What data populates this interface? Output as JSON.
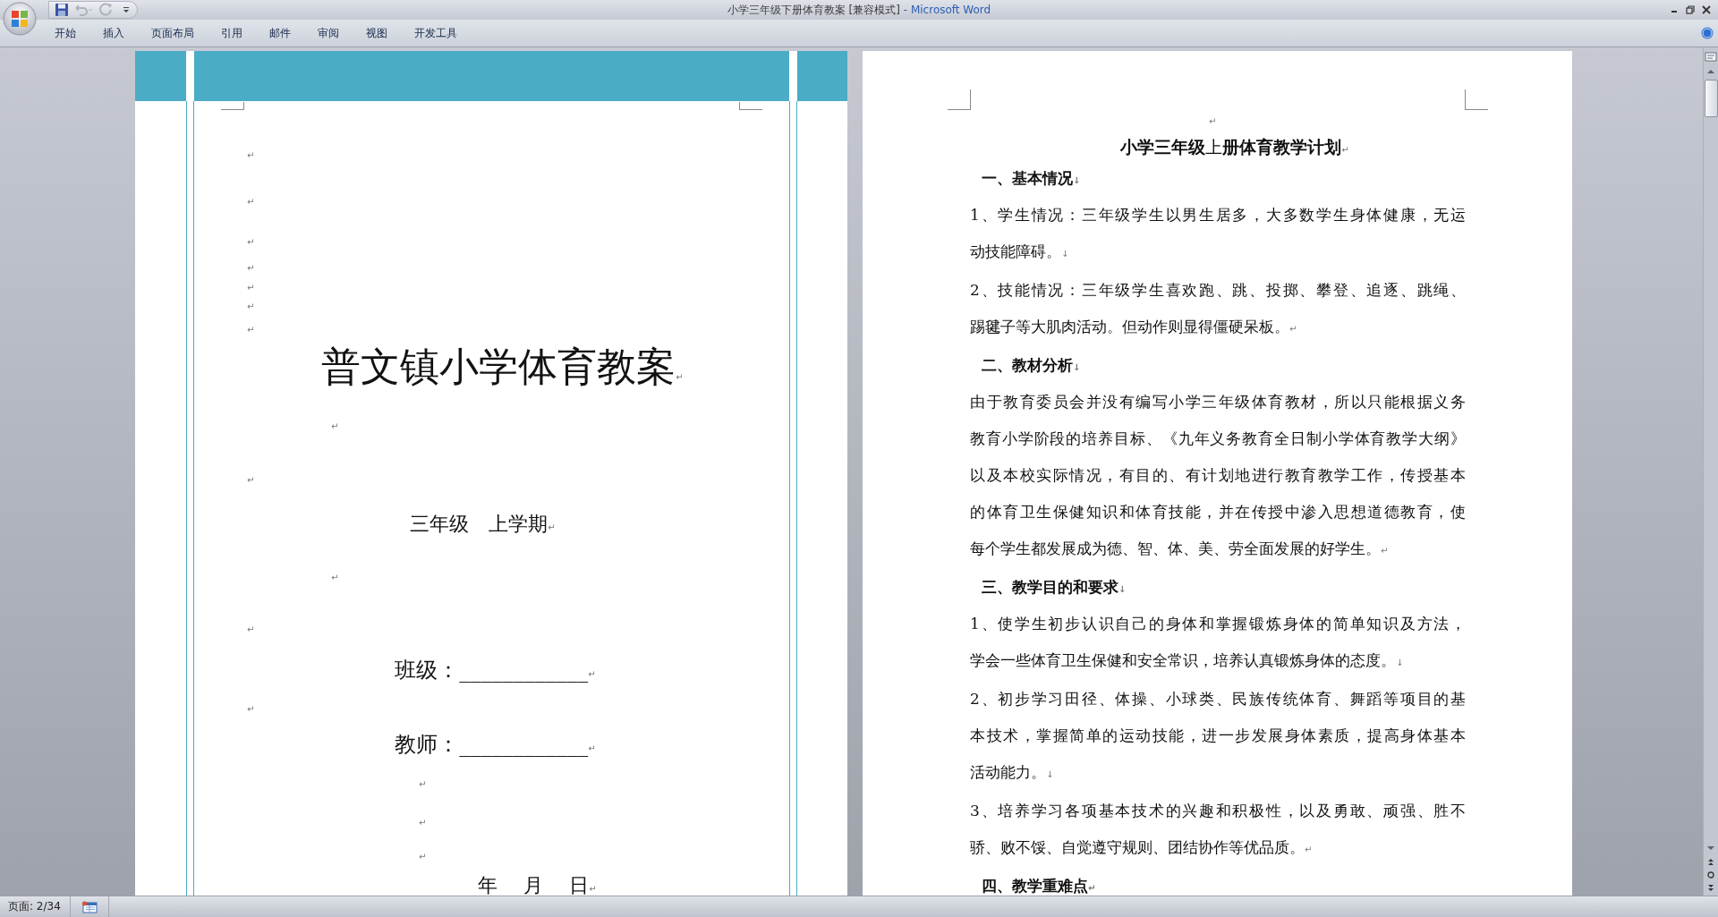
{
  "window": {
    "document_title": "小学三年级下册体育教案 [兼容模式]",
    "app_label": "- Microsoft Word"
  },
  "quick_access": [
    {
      "kind": "save",
      "disabled": false
    },
    {
      "kind": "undo",
      "disabled": true
    },
    {
      "kind": "redo",
      "disabled": true
    },
    {
      "kind": "customize",
      "disabled": false
    }
  ],
  "ribbon_tabs": [
    {
      "label": "开始",
      "selected": false
    },
    {
      "label": "插入",
      "selected": false
    },
    {
      "label": "页面布局",
      "selected": false
    },
    {
      "label": "引用",
      "selected": false
    },
    {
      "label": "邮件",
      "selected": false
    },
    {
      "label": "审阅",
      "selected": false
    },
    {
      "label": "视图",
      "selected": false
    },
    {
      "label": "开发工具",
      "selected": false
    }
  ],
  "left_page": {
    "paragraphs": [
      {
        "kind": "blank",
        "mark": "↵"
      },
      {
        "kind": "blank",
        "mark": "↵"
      },
      {
        "kind": "blank",
        "mark": "↵"
      },
      {
        "kind": "blank",
        "mark": "↵"
      },
      {
        "kind": "blank",
        "mark": "↵"
      },
      {
        "kind": "blank",
        "mark": "↵"
      },
      {
        "kind": "blank",
        "mark": "↵"
      },
      {
        "kind": "title",
        "text": "普文镇小学体育教案",
        "mark": "↵"
      },
      {
        "kind": "blank",
        "mark": "↵"
      },
      {
        "kind": "blank",
        "mark": "↵"
      },
      {
        "kind": "subtitle",
        "text": "三年级　上学期",
        "mark": "↵"
      },
      {
        "kind": "blank",
        "mark": "↵"
      },
      {
        "kind": "blank",
        "mark": "↵"
      },
      {
        "kind": "field",
        "text": "班级：____________",
        "mark": "↵"
      },
      {
        "kind": "blank",
        "mark": "↵"
      },
      {
        "kind": "field",
        "text": "教师：____________",
        "mark": "↵"
      },
      {
        "kind": "blank",
        "mark": "↵"
      },
      {
        "kind": "blank",
        "mark": "↵"
      },
      {
        "kind": "blank",
        "mark": "↵"
      },
      {
        "kind": "date",
        "text": "年　 月　 日",
        "mark": "↵"
      }
    ]
  },
  "right_page": {
    "paragraphs": [
      {
        "kind": "blank",
        "mark": "↵"
      },
      {
        "kind": "title",
        "text": "**小学三年级**上**册体育教学计划**",
        "mark": "↵"
      },
      {
        "kind": "heading",
        "text": "一、基本情况",
        "mark": "↓"
      },
      {
        "kind": "body",
        "lines": [
          "1、学生情况：三年级学生以男生居多，大多数学生身体健康，无运",
          "动技能障碍。"
        ],
        "mark": "↓"
      },
      {
        "kind": "body",
        "lines": [
          "2、技能情况：三年级学生喜欢跑、跳、投掷、攀登、追逐、跳绳、",
          "踢毽子等大肌肉活动。但动作则显得僵硬呆板。"
        ],
        "mark": "↵"
      },
      {
        "kind": "heading",
        "text": "二、教材分析",
        "mark": "↓"
      },
      {
        "kind": "body",
        "lines": [
          "由于教育委员会并没有编写小学三年级体育教材，所以只能根据义务",
          "教育小学阶段的培养目标、《九年义务教育全日制小学体育教学大纲》",
          "以及本校实际情况，有目的、有计划地进行教育教学工作，传授基本",
          "的体育卫生保健知识和体育技能，并在传授中渗入思想道德教育，使",
          "每个学生都发展成为德、智、体、美、劳全面发展的好学生。"
        ],
        "mark": "↵"
      },
      {
        "kind": "heading",
        "text": "三、教学目的和要求",
        "mark": "↓"
      },
      {
        "kind": "body",
        "lines": [
          "1、使学生初步认识自己的身体和掌握锻炼身体的简单知识及方法，",
          "学会一些体育卫生保健和安全常识，培养认真锻炼身体的态度。"
        ],
        "mark": "↓"
      },
      {
        "kind": "body",
        "lines": [
          "2、初步学习田径、体操、小球类、民族传统体育、舞蹈等项目的基",
          "本技术，掌握简单的运动技能，进一步发展身体素质，提高身体基本",
          "活动能力。"
        ],
        "mark": "↓"
      },
      {
        "kind": "body",
        "lines": [
          "3、培养学习各项基本技术的兴趣和积极性，以及勇敢、顽强、胜不",
          "骄、败不馁、自觉遵守规则、团结协作等优品质。"
        ],
        "mark": "↵"
      },
      {
        "kind": "heading",
        "text": "四、教学重难点",
        "mark": "↵"
      }
    ]
  },
  "status_bar": {
    "page": "页面: 2/34"
  }
}
